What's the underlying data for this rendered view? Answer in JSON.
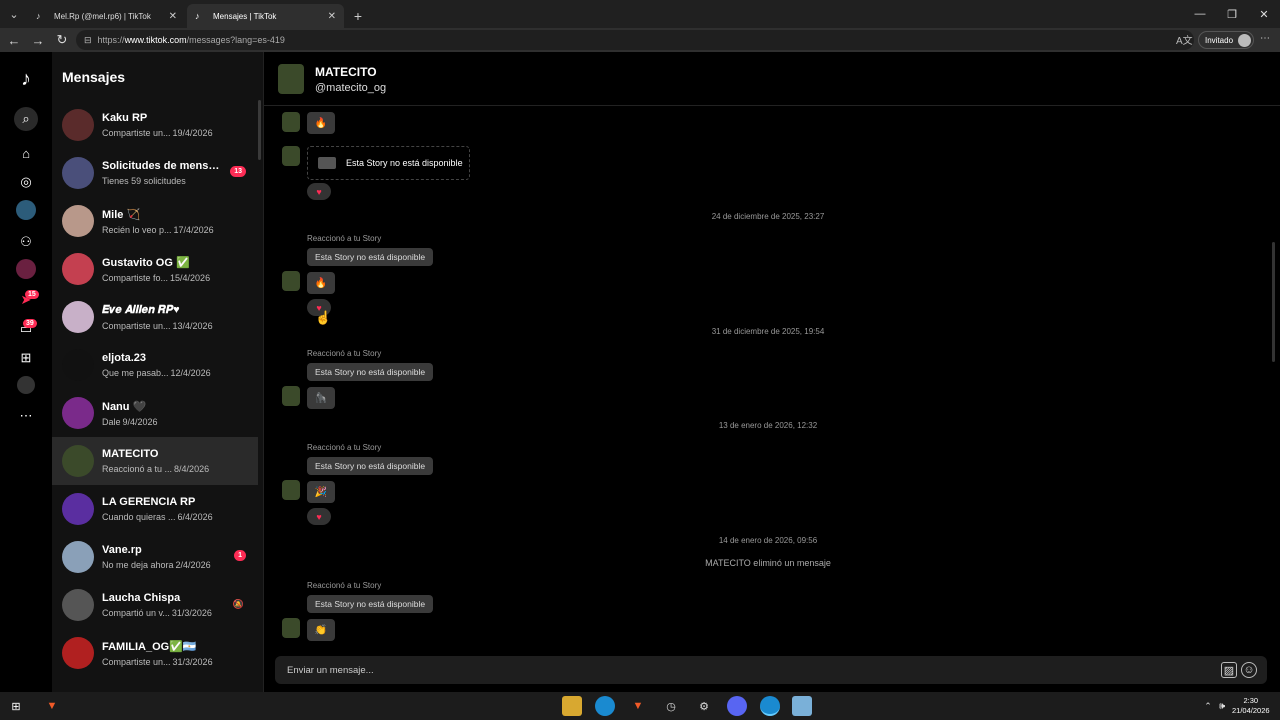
{
  "browser": {
    "tabs": [
      {
        "title": "Mel.Rp (@mel.rp6) | TikTok",
        "active": false
      },
      {
        "title": "Mensajes | TikTok",
        "active": true
      }
    ],
    "url_prefix": "https://",
    "url_host": "www.tiktok.com",
    "url_path": "/messages?lang=es-419",
    "profile_label": "Invitado"
  },
  "rail": {
    "badge_activity": "15",
    "badge_messages": "39"
  },
  "sidebar": {
    "title": "Mensajes",
    "conversations": [
      {
        "name": "Kaku RP",
        "preview": "Compartiste un...",
        "date": "19/4/2026",
        "color": "#5a2b2b"
      },
      {
        "name": "Solicitudes de mensaj...",
        "preview": "Tienes 59 solicitudes",
        "date": "",
        "badge": "13",
        "color": "#4a4f7a"
      },
      {
        "name": "Mile 🏹",
        "preview": "Recién lo veo p...",
        "date": "17/4/2026",
        "color": "#b8988a"
      },
      {
        "name": "Gustavito OG ✅",
        "preview": "Compartiste fo...",
        "date": "15/4/2026",
        "color": "#c44050"
      },
      {
        "name": "𝑬𝒗𝒆 𝑨𝒊𝒊𝒍𝒆𝒏 𝑹𝑷♥",
        "preview": "Compartiste un...",
        "date": "13/4/2026",
        "color": "#c8b0c8"
      },
      {
        "name": "eljota.23",
        "preview": "Que me pasab...",
        "date": "12/4/2026",
        "color": "#111111"
      },
      {
        "name": "Nanu 🖤",
        "preview": "Dale",
        "date": "9/4/2026",
        "color": "#7a2a8a"
      },
      {
        "name": "MATECITO",
        "preview": "Reaccionó a tu ...",
        "date": "8/4/2026",
        "color": "#3b4a2a",
        "active": true
      },
      {
        "name": "LA GERENCIA RP",
        "preview": "Cuando quieras ...",
        "date": "6/4/2026",
        "color": "#5a2ea0"
      },
      {
        "name": "Vane.rp",
        "preview": "No me deja ahora",
        "date": "2/4/2026",
        "badge": "1",
        "color": "#8aa0b8"
      },
      {
        "name": "Laucha Chispa",
        "preview": "Compartió un v...",
        "date": "31/3/2026",
        "muted": true,
        "color": "#555555"
      },
      {
        "name": "FAMILIA_OG✅🇦🇷",
        "preview": "Compartiste un...",
        "date": "31/3/2026",
        "color": "#b02020"
      }
    ]
  },
  "chat": {
    "name": "MATECITO",
    "handle": "@matecito_og",
    "story_unavailable": "Esta Story no está disponible",
    "reacted_label": "Reaccionó a tu Story",
    "timestamps": [
      "24 de diciembre de 2025, 23:27",
      "31 de diciembre de 2025, 19:54",
      "13 de enero de 2026, 12:32",
      "14 de enero de 2026, 09:56"
    ],
    "deleted_msg": "MATECITO eliminó un mensaje",
    "emojis": [
      "🔥",
      "🔥",
      "🦍",
      "🎉",
      "👏"
    ],
    "composer_placeholder": "Enviar un mensaje..."
  },
  "taskbar": {
    "time": "2:30",
    "date": "21/04/2026"
  }
}
